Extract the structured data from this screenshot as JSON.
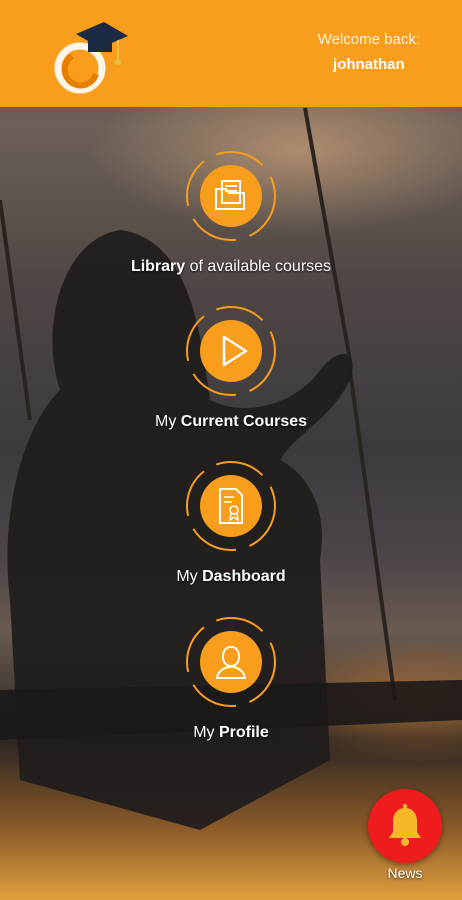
{
  "header": {
    "welcome_label": "Welcome back:",
    "username": "johnathan",
    "background_color": "#f99d1c"
  },
  "menu": [
    {
      "icon": "folder-icon",
      "bold": "Library",
      "rest": " of available courses",
      "bold_first": true
    },
    {
      "icon": "play-icon",
      "plain": "My ",
      "bold": "Current Courses",
      "bold_first": false
    },
    {
      "icon": "certificate-icon",
      "plain": "My ",
      "bold": "Dashboard",
      "bold_first": false
    },
    {
      "icon": "user-icon",
      "plain": "My ",
      "bold": "Profile",
      "bold_first": false
    }
  ],
  "news": {
    "label": "News",
    "icon": "bell-icon",
    "color": "#ee1c1c"
  },
  "accent_color": "#f99d1c"
}
